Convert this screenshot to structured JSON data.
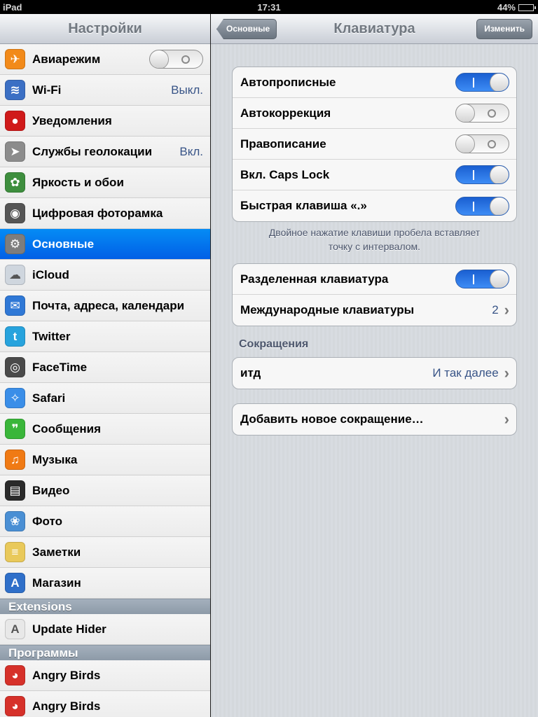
{
  "statusbar": {
    "device": "iPad",
    "time": "17:31",
    "battery": "44%",
    "battery_fraction": 0.44
  },
  "sidebar": {
    "title": "Настройки",
    "items": [
      {
        "name": "airplane-mode",
        "label": "Авиарежим",
        "icon": "airplane-icon",
        "color": "#f28a1a",
        "glyph": "✈",
        "toggle": "off"
      },
      {
        "name": "wifi",
        "label": "Wi-Fi",
        "icon": "wifi-icon",
        "color": "#3b6fc4",
        "glyph": "≋",
        "value": "Выкл."
      },
      {
        "name": "notifications",
        "label": "Уведомления",
        "icon": "notifications-icon",
        "color": "#d01a1a",
        "glyph": "●"
      },
      {
        "name": "location",
        "label": "Службы геолокации",
        "icon": "location-icon",
        "color": "#8c8c8c",
        "glyph": "➤",
        "value": "Вкл."
      },
      {
        "name": "brightness",
        "label": "Яркость и обои",
        "icon": "flower-icon",
        "color": "#3e8e3e",
        "glyph": "✿"
      },
      {
        "name": "picture-frame",
        "label": "Цифровая фоторамка",
        "icon": "picture-frame-icon",
        "color": "#555555",
        "glyph": "◉"
      },
      {
        "name": "general",
        "label": "Основные",
        "icon": "gear-icon",
        "color": "#7d7d7d",
        "glyph": "⚙",
        "selected": true
      },
      {
        "name": "icloud",
        "label": "iCloud",
        "icon": "cloud-icon",
        "color": "#cfd6de",
        "glyph": "☁"
      },
      {
        "name": "mail",
        "label": "Почта, адреса, календари",
        "icon": "mail-icon",
        "color": "#2f78d6",
        "glyph": "✉"
      },
      {
        "name": "twitter",
        "label": "Twitter",
        "icon": "twitter-bird-icon",
        "color": "#27a3dd",
        "glyph": "t"
      },
      {
        "name": "facetime",
        "label": "FaceTime",
        "icon": "facetime-icon",
        "color": "#4a4a4a",
        "glyph": "◎"
      },
      {
        "name": "safari",
        "label": "Safari",
        "icon": "compass-icon",
        "color": "#3a8ee8",
        "glyph": "✧"
      },
      {
        "name": "messages",
        "label": "Сообщения",
        "icon": "message-bubble-icon",
        "color": "#3ab63a",
        "glyph": "❞"
      },
      {
        "name": "music",
        "label": "Музыка",
        "icon": "music-note-icon",
        "color": "#f07a14",
        "glyph": "♫"
      },
      {
        "name": "video",
        "label": "Видео",
        "icon": "clapperboard-icon",
        "color": "#2a2a2a",
        "glyph": "▤"
      },
      {
        "name": "photos",
        "label": "Фото",
        "icon": "sunflower-icon",
        "color": "#4a8fd4",
        "glyph": "❀"
      },
      {
        "name": "notes",
        "label": "Заметки",
        "icon": "notepad-icon",
        "color": "#e9c95a",
        "glyph": "≡"
      },
      {
        "name": "store",
        "label": "Магазин",
        "icon": "app-store-icon",
        "color": "#2f6fc9",
        "glyph": "A"
      }
    ],
    "section_extensions": "Extensions",
    "extensions": [
      {
        "name": "update-hider",
        "label": "Update Hider",
        "icon": "app-store-outline-icon",
        "color": "#e8e8e8",
        "glyph": "A"
      }
    ],
    "section_apps": "Программы",
    "apps": [
      {
        "name": "angry-birds-1",
        "label": "Angry Birds",
        "icon": "angry-bird-icon",
        "color": "#d6312a",
        "glyph": "◕"
      },
      {
        "name": "angry-birds-2",
        "label": "Angry Birds",
        "icon": "angry-bird-hd-icon",
        "color": "#d6312a",
        "glyph": "◕"
      }
    ]
  },
  "detail": {
    "back_label": "Основные",
    "title": "Клавиатура",
    "edit_label": "Изменить",
    "group1": [
      {
        "name": "auto-capitalization",
        "label": "Автопрописные",
        "toggle": "on"
      },
      {
        "name": "auto-correction",
        "label": "Автокоррекция",
        "toggle": "off"
      },
      {
        "name": "spelling",
        "label": "Правописание",
        "toggle": "off"
      },
      {
        "name": "caps-lock",
        "label": "Вкл. Caps Lock",
        "toggle": "on"
      },
      {
        "name": "period-shortcut",
        "label": "Быстрая клавиша «.»",
        "toggle": "on"
      }
    ],
    "group1_footer_line1": "Двойное нажатие клавиши пробела вставляет",
    "group1_footer_line2": "точку с интервалом.",
    "group2": [
      {
        "name": "split-keyboard",
        "label": "Разделенная клавиатура",
        "toggle": "on"
      },
      {
        "name": "international-keyboards",
        "label": "Международные клавиатуры",
        "value": "2"
      }
    ],
    "shortcuts_header": "Сокращения",
    "shortcut": {
      "label": "итд",
      "value": "И так далее"
    },
    "add_shortcut": "Добавить новое сокращение…"
  }
}
